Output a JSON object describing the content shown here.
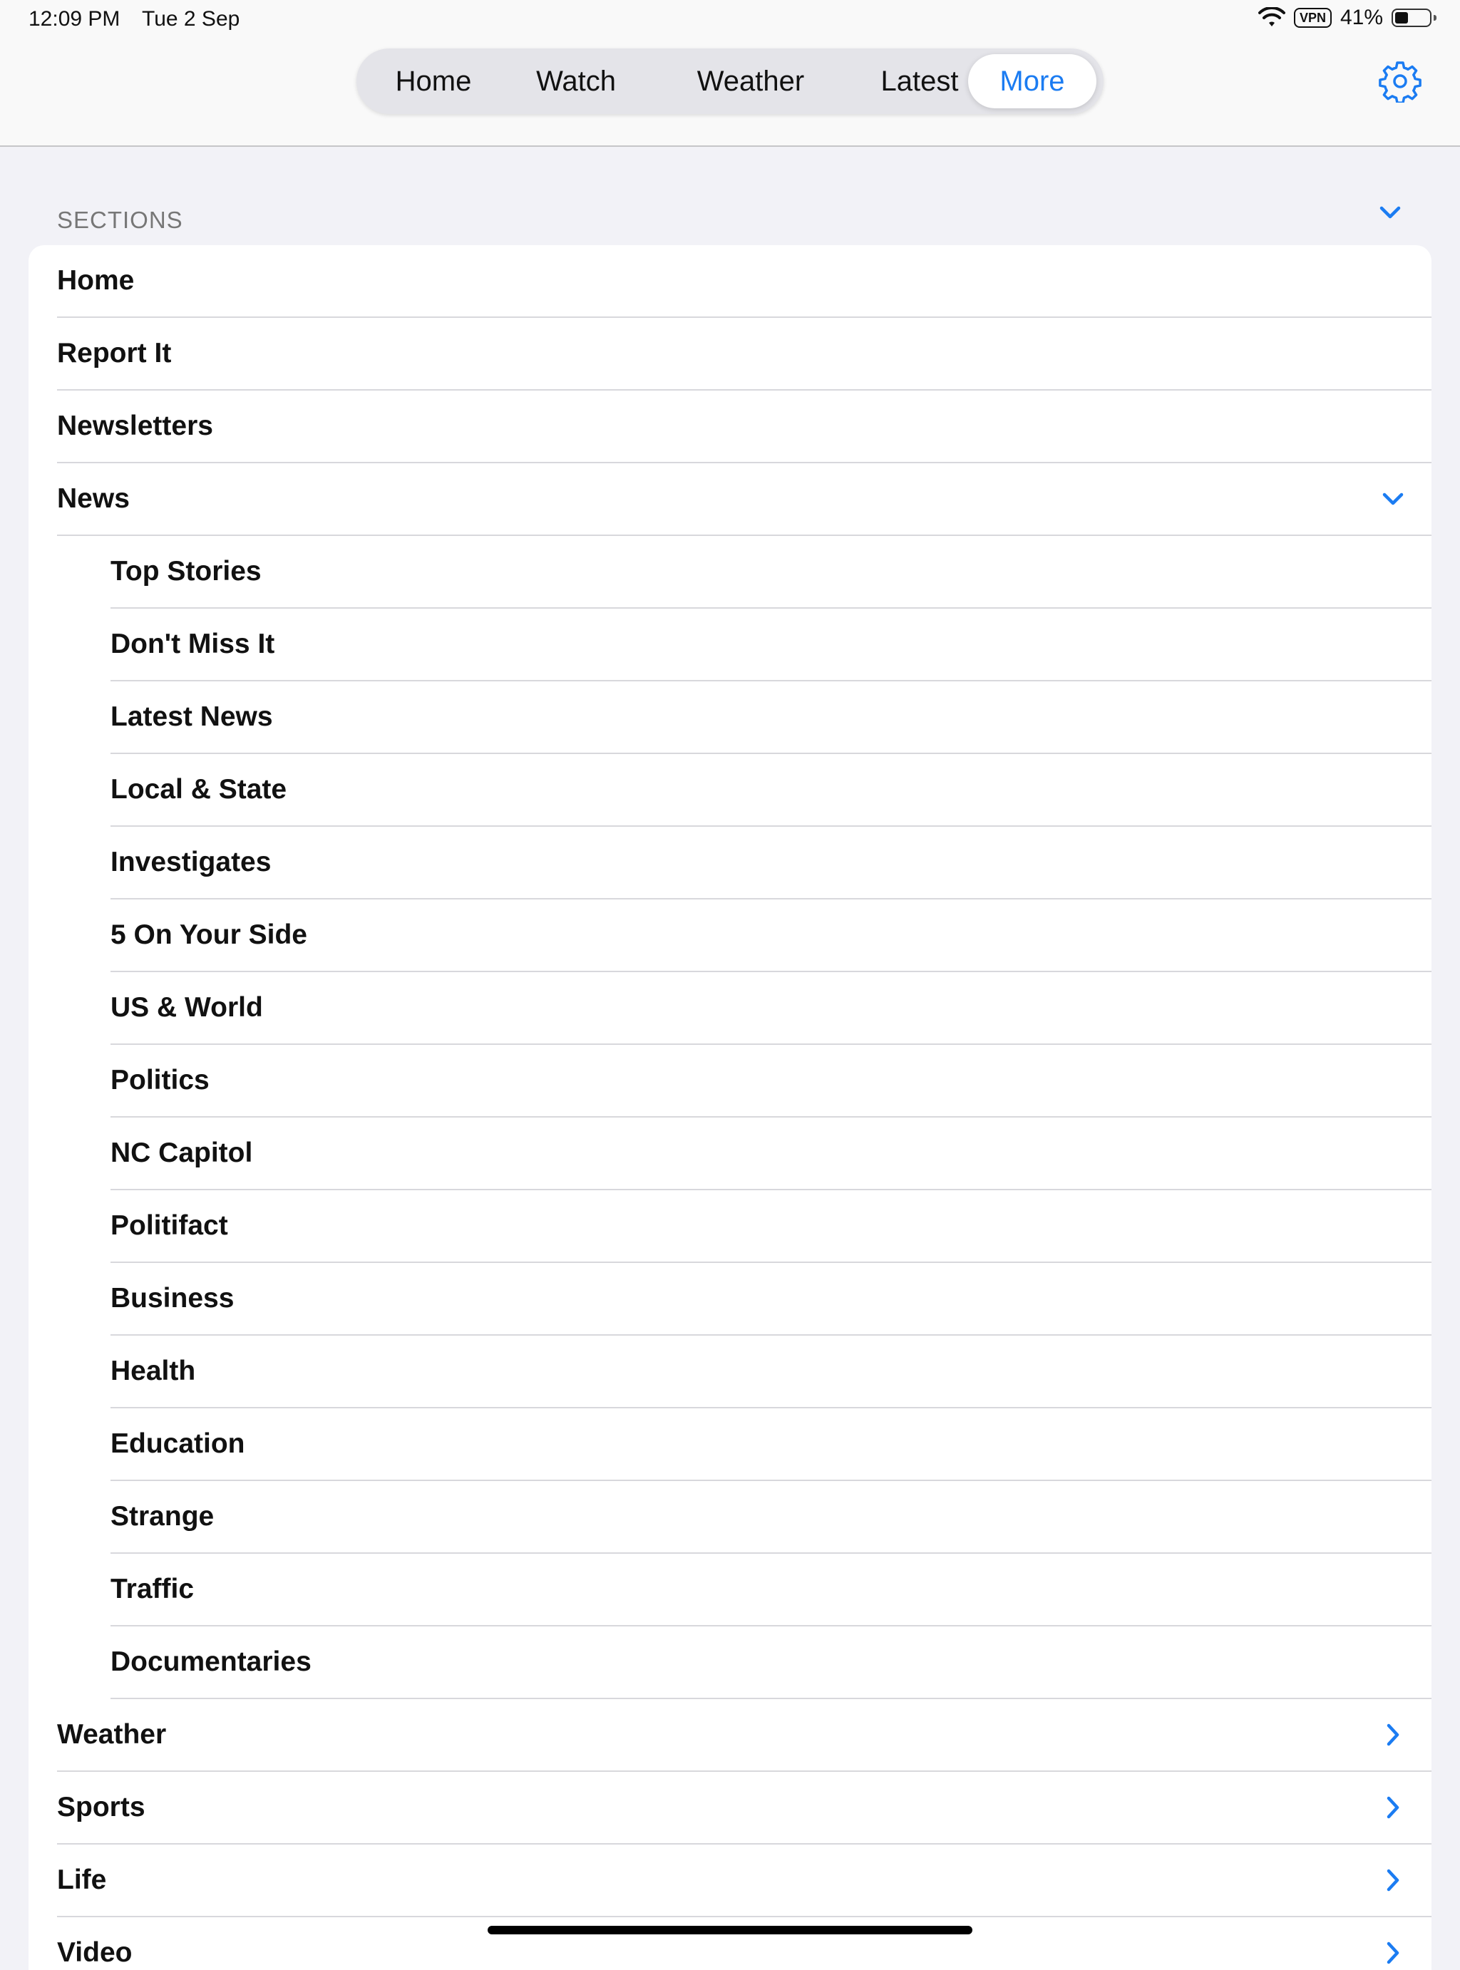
{
  "status_bar": {
    "time": "12:09 PM",
    "date": "Tue 2 Sep",
    "vpn": "VPN",
    "battery": "41%",
    "battery_level": 0.41
  },
  "nav_tabs": [
    {
      "label": "Home",
      "active": false
    },
    {
      "label": "Watch",
      "active": false
    },
    {
      "label": "Weather",
      "active": false
    },
    {
      "label": "Latest",
      "active": false
    },
    {
      "label": "More",
      "active": true
    }
  ],
  "accent_color": "#1b7cf2",
  "sections": {
    "header": "SECTIONS",
    "items": [
      {
        "label": "Home"
      },
      {
        "label": "Report It"
      },
      {
        "label": "Newsletters"
      },
      {
        "label": "News",
        "expanded": true
      },
      {
        "label": "Top Stories"
      },
      {
        "label": "Don't Miss It"
      },
      {
        "label": "Latest News"
      },
      {
        "label": "Local & State"
      },
      {
        "label": "Investigates"
      },
      {
        "label": "5 On Your Side"
      },
      {
        "label": "US & World"
      },
      {
        "label": "Politics"
      },
      {
        "label": "NC Capitol"
      },
      {
        "label": "Politifact"
      },
      {
        "label": "Business"
      },
      {
        "label": "Health"
      },
      {
        "label": "Education"
      },
      {
        "label": "Strange"
      },
      {
        "label": "Traffic"
      },
      {
        "label": "Documentaries"
      },
      {
        "label": "Weather"
      },
      {
        "label": "Sports"
      },
      {
        "label": "Life"
      },
      {
        "label": "Video"
      }
    ]
  }
}
